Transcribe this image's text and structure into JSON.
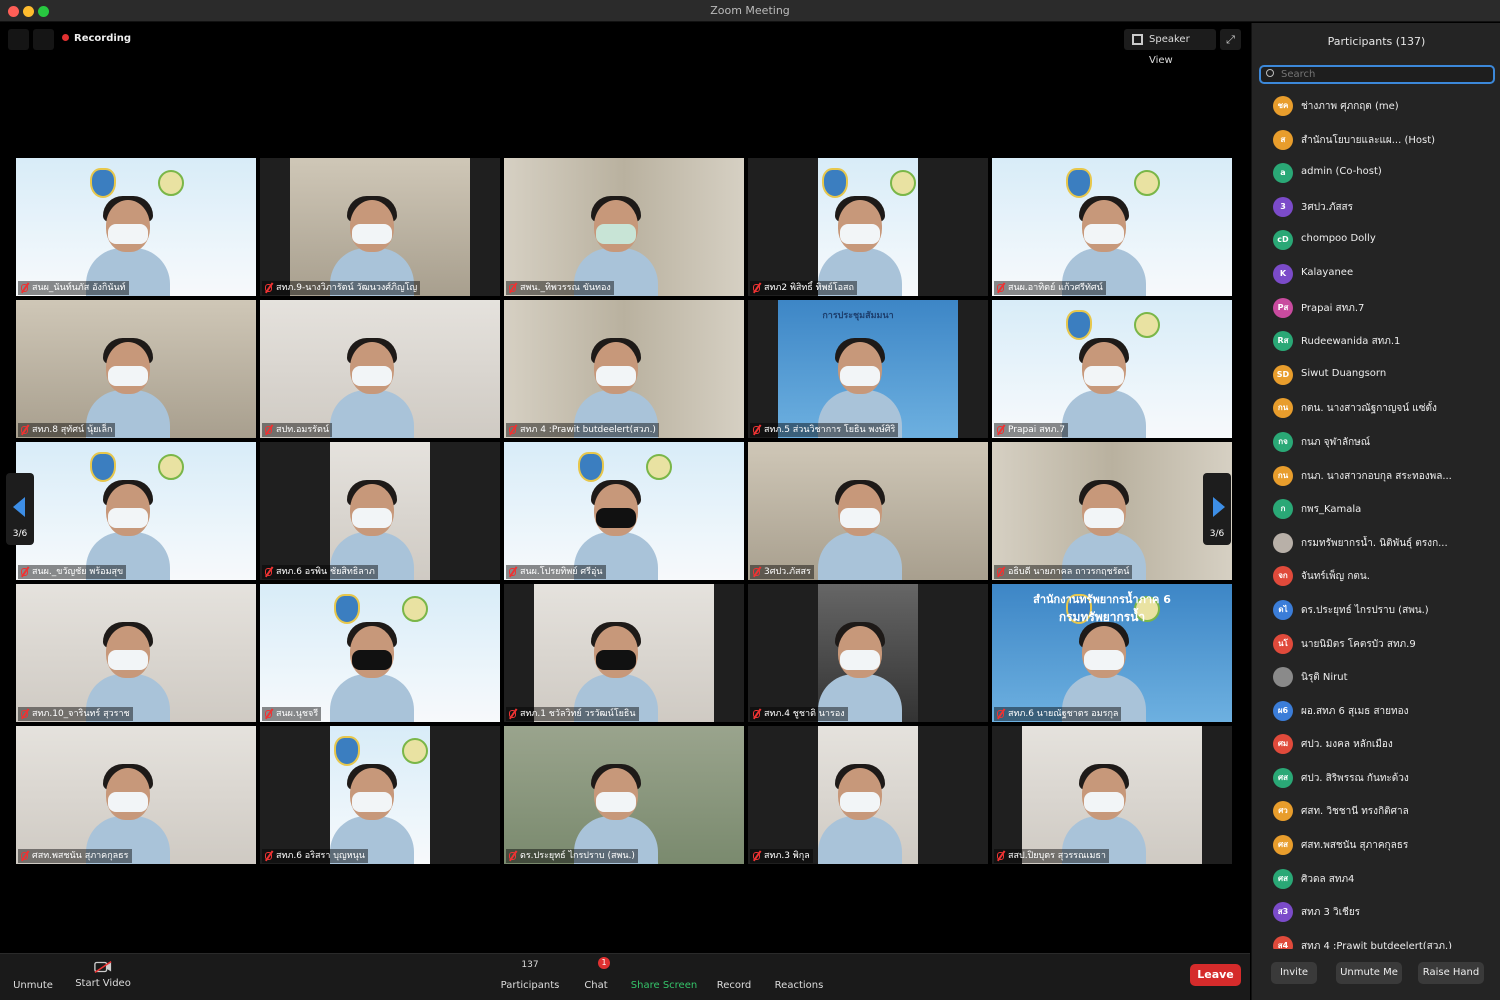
{
  "window": {
    "title": "Zoom Meeting"
  },
  "top": {
    "recording": "Recording",
    "speaker_view": "Speaker View"
  },
  "pager": {
    "left": "3/6",
    "right": "3/6"
  },
  "tiles": [
    {
      "name": "สนผ_นันท์นภัส อังกินันท์"
    },
    {
      "name": "สทภ.9-นางวิภารัตน์ วัฒนวงศ์ภิญโญ"
    },
    {
      "name": "สพน._ทิพวรรณ ขันทอง"
    },
    {
      "name": "สทภ2 พิสิทธิ์ ทิพย์โอสถ"
    },
    {
      "name": "สนผ.อาทิตย์ แก้วศรีทัศน์"
    },
    {
      "name": "สทภ.8 สุทัศน์ นุ้ยเล็ก"
    },
    {
      "name": "สปท.อมรรัตน์"
    },
    {
      "name": "สทภ 4 :Prawit butdeelert(สวภ.)"
    },
    {
      "name": "สทภ.5 ส่วนวิชาการ โยธิน พงษ์ศิริ"
    },
    {
      "name": "Prapai สทภ.7"
    },
    {
      "name": "สนผ._ขวัญชัย พร้อมสุข"
    },
    {
      "name": "สทภ.6 อรพิน ชัยสิทธิลาภ"
    },
    {
      "name": "สนผ.โปรยทิพย์ ศรีอุ่น"
    },
    {
      "name": "3ศปว.ภัสสร"
    },
    {
      "name": "อธิบดี นายภาคล ถาวรกฤชรัตน์"
    },
    {
      "name": "สทภ.10_จารินทร์ สุวราช"
    },
    {
      "name": "สนผ.นุชจรี"
    },
    {
      "name": "สทภ.1 ชวัลวิทย์ วรวัฒน์โยธิน"
    },
    {
      "name": "สทภ.4 ชูชาติ นารอง"
    },
    {
      "name": "สทภ.6 นายณัฐชาตร อมรกุล"
    },
    {
      "name": "ศสท.พสชนัน สุภาคกุลธร"
    },
    {
      "name": "สทภ.6 อริสรา บุญหนุน"
    },
    {
      "name": "ดร.ประยุทธ์ ไกรปราบ (สพน.)"
    },
    {
      "name": "สทภ.3 พิกุล"
    },
    {
      "name": "สสป.ปิยบุตร สุวรรณเมธา"
    }
  ],
  "screen_share": {
    "line1": "การประชุมสัมมนา",
    "line2": "สำนักงานทรัพยากรน้ำภาค 6",
    "line3": "กรมทรัพยากรน้ำ"
  },
  "toolbar": {
    "unmute": "Unmute",
    "start_video": "Start Video",
    "participants_count": "137",
    "participants": "Participants",
    "chat_badge": "1",
    "chat": "Chat",
    "share_screen": "Share Screen",
    "record": "Record",
    "reactions": "Reactions",
    "leave": "Leave"
  },
  "panel": {
    "title": "Participants (137)",
    "search_placeholder": "Search",
    "participants": [
      {
        "initials": "ชค",
        "name": "ช่างภาพ ศุภกฤต (me)",
        "color": "#e89d2c"
      },
      {
        "initials": "ส",
        "name": "สำนักนโยบายและแผ...  (Host)",
        "color": "#e89d2c"
      },
      {
        "initials": "a",
        "name": "admin (Co-host)",
        "color": "#2aa876"
      },
      {
        "initials": "3",
        "name": "3ศปว.ภัสสร",
        "color": "#7b4bc9"
      },
      {
        "initials": "cD",
        "name": "chompoo Dolly",
        "color": "#2aa876"
      },
      {
        "initials": "K",
        "name": "Kalayanee",
        "color": "#7b4bc9"
      },
      {
        "initials": "Pส",
        "name": "Prapai สทภ.7",
        "color": "#c94b9f"
      },
      {
        "initials": "Rส",
        "name": "Rudeewanida สทภ.1",
        "color": "#2aa876"
      },
      {
        "initials": "SD",
        "name": "Siwut Duangsorn",
        "color": "#e89d2c"
      },
      {
        "initials": "กน",
        "name": "กตน. นางสาวณัฐกาญจน์ แซ่ตั้ง",
        "color": "#e89d2c"
      },
      {
        "initials": "กจ",
        "name": "กนภ จุฬาลักษณ์",
        "color": "#2aa876"
      },
      {
        "initials": "กน",
        "name": "กนภ. นางสาวกอบกุล สระทองพล...",
        "color": "#e89d2c"
      },
      {
        "initials": "ก",
        "name": "กพร_Kamala",
        "color": "#2aa876"
      },
      {
        "initials": "",
        "name": "กรมทรัพยากรน้ำ. นิติพันธุ์ ตรงก...",
        "color": "#b8b0a8"
      },
      {
        "initials": "จก",
        "name": "จันทร์เพ็ญ กตน.",
        "color": "#e04a3b"
      },
      {
        "initials": "ดไ",
        "name": "ดร.ประยุทธ์ ไกรปราบ (สพน.)",
        "color": "#3b7dd8"
      },
      {
        "initials": "นโ",
        "name": "นายนิมิตร โคตรบัว สทภ.9",
        "color": "#e04a3b"
      },
      {
        "initials": "",
        "name": "นิรุติ Nirut",
        "color": "#8a8a8a"
      },
      {
        "initials": "ผ6",
        "name": "ผอ.สทภ 6 สุเมธ สายทอง",
        "color": "#3b7dd8"
      },
      {
        "initials": "ศม",
        "name": "ศปว. มงคล หลักเมือง",
        "color": "#e04a3b"
      },
      {
        "initials": "ศส",
        "name": "ศปว. สิริพรรณ กันทะด้วง",
        "color": "#2aa876"
      },
      {
        "initials": "ศว",
        "name": "ศสท. วิชชานี ทรงกิติศาล",
        "color": "#e89d2c"
      },
      {
        "initials": "ศส",
        "name": "ศสท.พสชนัน สุภาคกุลธร",
        "color": "#e89d2c"
      },
      {
        "initials": "ศส",
        "name": "ศิวดล สทภ4",
        "color": "#2aa876"
      },
      {
        "initials": "ส3",
        "name": "สทภ 3 วิเชียร",
        "color": "#7b4bc9"
      },
      {
        "initials": "ส4",
        "name": "สทภ 4 :Prawit butdeelert(สวภ.)",
        "color": "#e04a3b"
      }
    ],
    "invite": "Invite",
    "unmute_me": "Unmute Me",
    "raise_hand": "Raise Hand"
  }
}
